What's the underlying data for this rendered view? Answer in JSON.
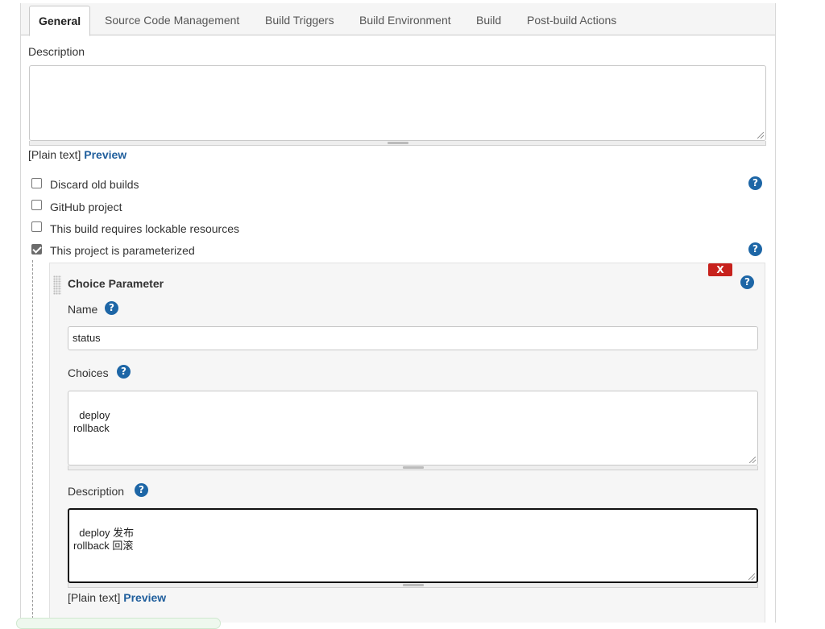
{
  "tabs": [
    {
      "label": "General",
      "active": true
    },
    {
      "label": "Source Code Management"
    },
    {
      "label": "Build Triggers"
    },
    {
      "label": "Build Environment"
    },
    {
      "label": "Build"
    },
    {
      "label": "Post-build Actions"
    }
  ],
  "general": {
    "description_label": "Description",
    "description_value": "",
    "plain_text": "[Plain text]",
    "preview": "Preview",
    "options": [
      {
        "label": "Discard old builds",
        "checked": false
      },
      {
        "label": "GitHub project",
        "checked": false
      },
      {
        "label": "This build requires lockable resources",
        "checked": false
      },
      {
        "label": "This project is parameterized",
        "checked": true
      }
    ]
  },
  "parameter": {
    "title": "Choice Parameter",
    "close_label": "X",
    "name_label": "Name",
    "name_value": "status",
    "choices_label": "Choices",
    "choices_value": "deploy\nrollback",
    "description_label": "Description",
    "description_value": "deploy 发布\nrollback 回滚",
    "plain_text": "[Plain text]",
    "preview": "Preview"
  },
  "help_glyph": "?",
  "colors": {
    "help_blue": "#1d66a6",
    "close_red": "#c7221d",
    "link_blue": "#1f5e9c"
  }
}
